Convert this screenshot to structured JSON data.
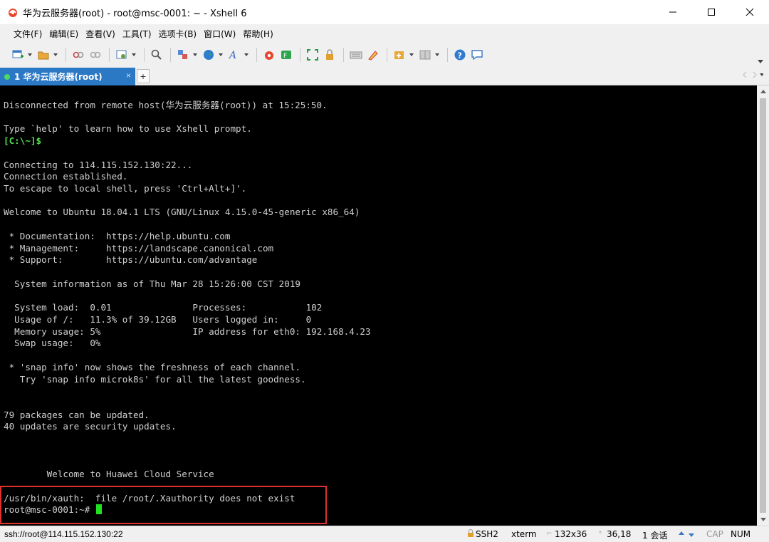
{
  "window": {
    "title": "华为云服务器(root) - root@msc-0001: ~ - Xshell 6"
  },
  "menu": {
    "items": [
      "文件(F)",
      "编辑(E)",
      "查看(V)",
      "工具(T)",
      "选项卡(B)",
      "窗口(W)",
      "帮助(H)"
    ]
  },
  "tab": {
    "label": "1 华为云服务器(root)",
    "close": "×",
    "add": "+"
  },
  "terminal": {
    "lines": [
      "Disconnected from remote host(华为云服务器(root)) at 15:25:50.",
      "",
      "Type `help' to learn how to use Xshell prompt.",
      "",
      "",
      "Connecting to 114.115.152.130:22...",
      "Connection established.",
      "To escape to local shell, press 'Ctrl+Alt+]'.",
      "",
      "Welcome to Ubuntu 18.04.1 LTS (GNU/Linux 4.15.0-45-generic x86_64)",
      "",
      " * Documentation:  https://help.ubuntu.com",
      " * Management:     https://landscape.canonical.com",
      " * Support:        https://ubuntu.com/advantage",
      "",
      "  System information as of Thu Mar 28 15:26:00 CST 2019",
      "",
      "  System load:  0.01               Processes:           102",
      "  Usage of /:   11.3% of 39.12GB   Users logged in:     0",
      "  Memory usage: 5%                 IP address for eth0: 192.168.4.23",
      "  Swap usage:   0%",
      "",
      " * 'snap info' now shows the freshness of each channel.",
      "   Try 'snap info microk8s' for all the latest goodness.",
      "",
      "",
      "79 packages can be updated.",
      "40 updates are security updates.",
      "",
      "",
      "",
      "        Welcome to Huawei Cloud Service",
      "",
      "/usr/bin/xauth:  file /root/.Xauthority does not exist",
      ""
    ],
    "local_prompt": "[C:\\~]$",
    "local_prompt_line": 3,
    "shell_prompt": "root@msc-0001:~# ",
    "shell_prompt_line": 34
  },
  "status": {
    "connection": "ssh://root@114.115.152.130:22",
    "protocol": "SSH2",
    "term": "xterm",
    "size": "132x36",
    "cursor_pos": "36,18",
    "sessions": "1 会话",
    "caps": "CAP",
    "num": "NUM"
  },
  "colors": {
    "tab_active": "#2b78c5",
    "terminal_bg": "#000000",
    "prompt": "#4ee04e",
    "highlight": "#e03030"
  }
}
